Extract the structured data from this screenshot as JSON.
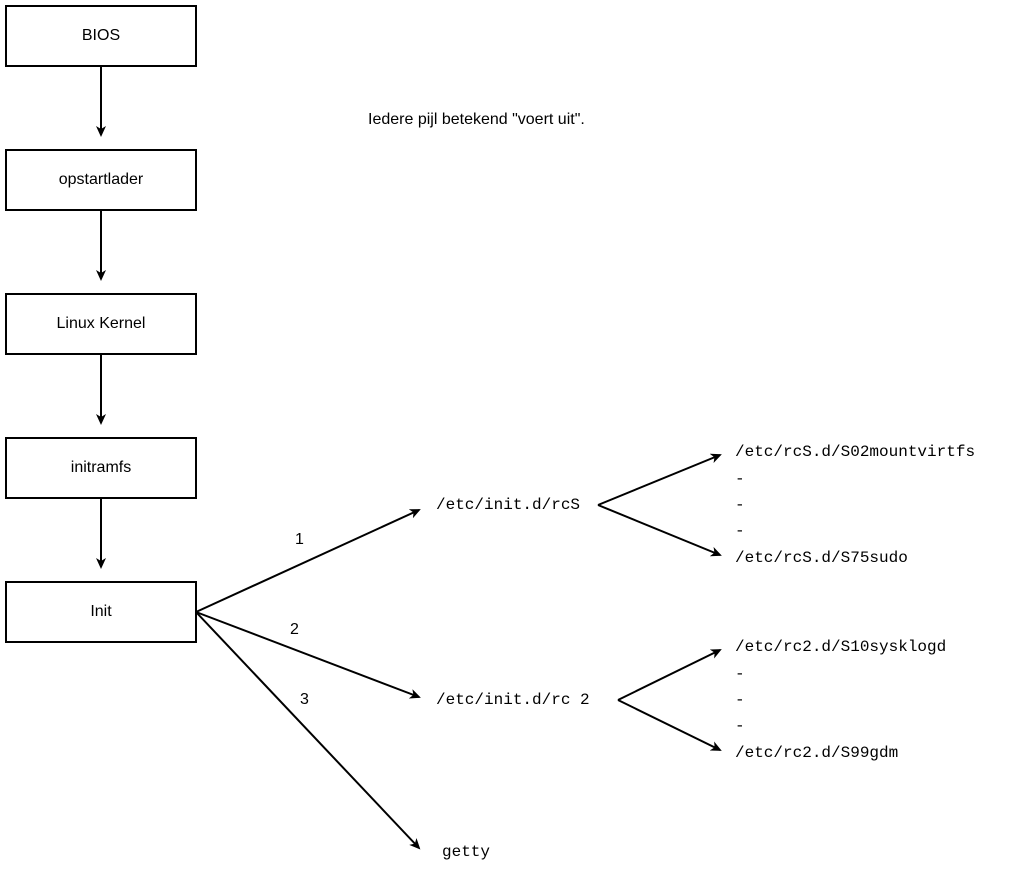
{
  "caption": "Iedere pijl betekend \"voert uit\".",
  "boxes": {
    "bios": "BIOS",
    "bootloader": "opstartlader",
    "kernel": "Linux Kernel",
    "initramfs": "initramfs",
    "init": "Init"
  },
  "labels": {
    "num1": "1",
    "num2": "2",
    "num3": "3"
  },
  "paths": {
    "rcS": "/etc/init.d/rcS",
    "rc2": "/etc/init.d/rc 2",
    "getty": "getty",
    "rcS_first": "/etc/rcS.d/S02mountvirtfs",
    "rcS_last": "/etc/rcS.d/S75sudo",
    "rc2_first": "/etc/rc2.d/S10sysklogd",
    "rc2_last": "/etc/rc2.d/S99gdm",
    "dash": "-"
  }
}
